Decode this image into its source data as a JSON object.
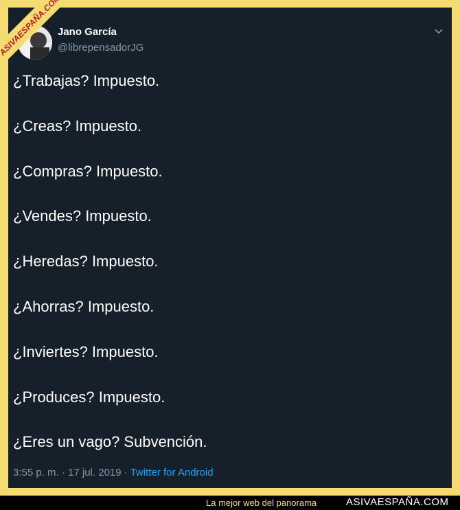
{
  "watermark": {
    "text": "ASIVAESPAÑA.COM"
  },
  "tweet": {
    "author_name": "Jano García",
    "author_handle": "@librepensadorJG",
    "lines": [
      "¿Trabajas? Impuesto.",
      "¿Creas? Impuesto.",
      "¿Compras? Impuesto.",
      "¿Vendes? Impuesto.",
      "¿Heredas? Impuesto.",
      "¿Ahorras? Impuesto.",
      "¿Inviertes? Impuesto.",
      "¿Produces? Impuesto.",
      "¿Eres un vago? Subvención."
    ],
    "timestamp": "3:55 p. m. · 17 jul. 2019 · ",
    "client": "Twitter for Android"
  },
  "footer": {
    "tagline": "La mejor web del panorama",
    "brand": "ASIVAESPAÑA.COM"
  },
  "colors": {
    "frame": "#f4dc72",
    "tweet_background": "#15202b",
    "secondary_text": "#8899a6",
    "link": "#1da1f2"
  },
  "icons": [
    "avatar",
    "chevron-down-icon"
  ]
}
